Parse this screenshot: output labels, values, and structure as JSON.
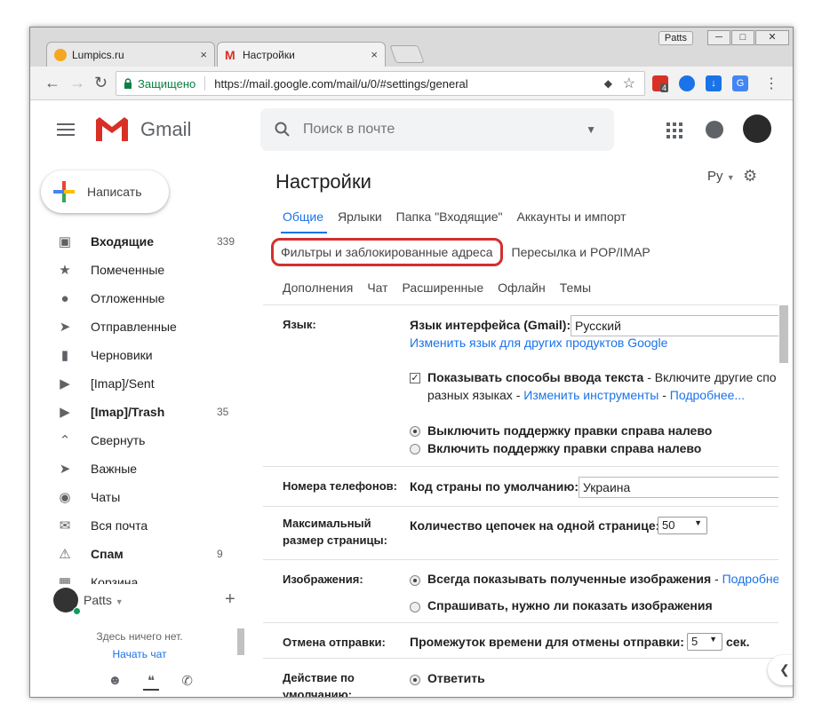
{
  "browser": {
    "tabs": [
      {
        "title": "Lumpics.ru",
        "close": "×"
      },
      {
        "title": "Настройки",
        "close": "×"
      }
    ],
    "window_user": "Patts",
    "window_buttons": [
      "─",
      "□",
      "✕"
    ],
    "secure_label": "Защищено",
    "url": "https://mail.google.com/mail/u/0/#settings/general",
    "ext_badge": "4"
  },
  "gmail": {
    "logo_text": "Gmail",
    "search_placeholder": "Поиск в почте"
  },
  "sidebar": {
    "compose_label": "Написать",
    "items": [
      {
        "label": "Входящие",
        "count": "339",
        "icon": "inbox-icon"
      },
      {
        "label": "Помеченные",
        "count": "",
        "icon": "star-icon"
      },
      {
        "label": "Отложенные",
        "count": "",
        "icon": "clock-icon"
      },
      {
        "label": "Отправленные",
        "count": "",
        "icon": "send-icon"
      },
      {
        "label": "Черновики",
        "count": "",
        "icon": "draft-icon"
      },
      {
        "label": "[Imap]/Sent",
        "count": "",
        "icon": "label-icon"
      },
      {
        "label": "[Imap]/Trash",
        "count": "35",
        "icon": "label-icon"
      },
      {
        "label": "Свернуть",
        "count": "",
        "icon": "chevron-up-icon"
      },
      {
        "label": "Важные",
        "count": "",
        "icon": "important-icon"
      },
      {
        "label": "Чаты",
        "count": "",
        "icon": "chat-icon"
      },
      {
        "label": "Вся почта",
        "count": "",
        "icon": "mail-icon"
      },
      {
        "label": "Спам",
        "count": "9",
        "icon": "spam-icon"
      },
      {
        "label": "Корзина",
        "count": "",
        "icon": "trash-icon"
      }
    ],
    "chat": {
      "user": "Patts",
      "empty_text": "Здесь ничего нет.",
      "start_chat": "Начать чат"
    }
  },
  "settings": {
    "title": "Настройки",
    "lang_short": "Ру",
    "tabs_row1": [
      "Общие",
      "Ярлыки",
      "Папка \"Входящие\"",
      "Аккаунты и импорт"
    ],
    "tabs_row2": [
      "Фильтры и заблокированные адреса",
      "Пересылка и POP/IMAP"
    ],
    "tabs_row3": [
      "Дополнения",
      "Чат",
      "Расширенные",
      "Офлайн",
      "Темы"
    ],
    "language": {
      "label": "Язык:",
      "interface_label": "Язык интерфейса (Gmail):",
      "interface_value": "Русский",
      "change_link": "Изменить язык для других продуктов Google",
      "input_methods_bold": "Показывать способы ввода текста",
      "input_methods_rest": " - Включите другие спо",
      "input_methods_line2": "разных языках - ",
      "change_tools": "Изменить инструменты",
      "more": "Подробнее...",
      "rtl_off": "Выключить поддержку правки справа налево",
      "rtl_on": "Включить поддержку правки справа налево"
    },
    "phone": {
      "label": "Номера телефонов:",
      "country_label": "Код страны по умолчанию:",
      "country_value": "Украина"
    },
    "page_size": {
      "label_line1": "Максимальный",
      "label_line2": "размер страницы:",
      "threads_label": "Количество цепочек на одной странице:",
      "threads_value": "50"
    },
    "images": {
      "label": "Изображения:",
      "always": "Всегда показывать полученные изображения",
      "always_link": "Подробне",
      "ask": "Спрашивать, нужно ли показать изображения"
    },
    "undo": {
      "label": "Отмена отправки:",
      "period_label": "Промежуток времени для отмены отправки:",
      "period_value": "5",
      "unit": "сек."
    },
    "default_action": {
      "label_line1": "Действие по",
      "label_line2": "умолчанию:",
      "reply": "Ответить"
    }
  }
}
